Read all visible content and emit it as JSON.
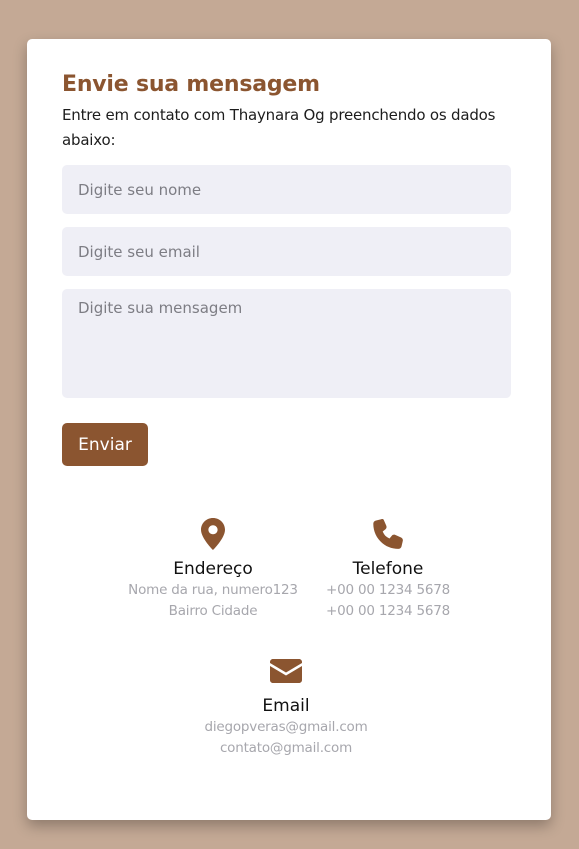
{
  "form": {
    "title": "Envie sua mensagem",
    "subtitle": "Entre em contato com Thaynara Og preenchendo os dados abaixo:",
    "name_placeholder": "Digite seu nome",
    "email_placeholder": "Digite seu email",
    "message_placeholder": "Digite sua mensagem",
    "submit_label": "Enviar"
  },
  "contact": {
    "address": {
      "icon": "map-marker-icon",
      "title": "Endereço",
      "lines": [
        "Nome da rua, numero123",
        "Bairro Cidade"
      ]
    },
    "phone": {
      "icon": "phone-icon",
      "title": "Telefone",
      "lines": [
        "+00 00 1234 5678",
        "+00 00 1234 5678"
      ]
    },
    "email": {
      "icon": "envelope-icon",
      "title": "Email",
      "lines": [
        "diegopveras@gmail.com",
        "contato@gmail.com"
      ]
    }
  },
  "colors": {
    "background": "#c4a995",
    "accent": "#8b5530",
    "field_bg": "#efeff6"
  }
}
